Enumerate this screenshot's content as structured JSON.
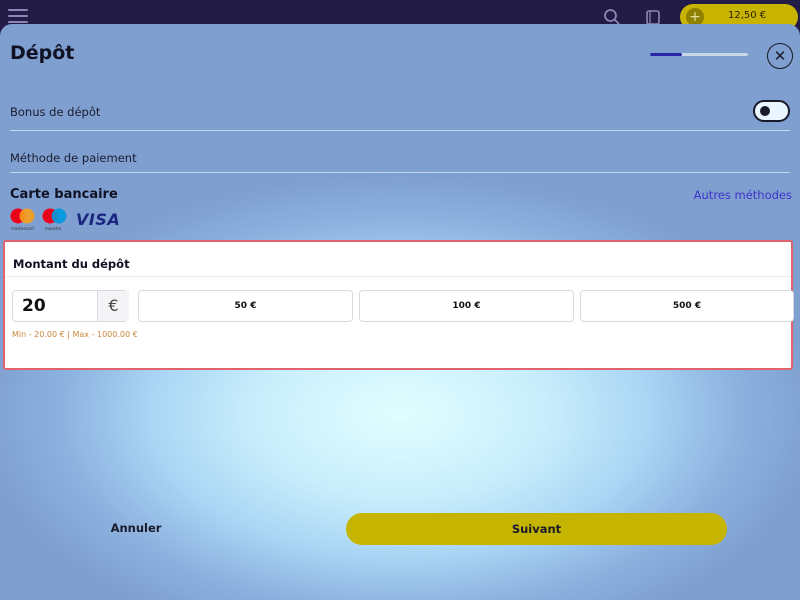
{
  "topbar": {
    "balance": "12,50 €",
    "add_label": "+",
    "icons": [
      "menu-icon",
      "search-icon",
      "wallet-icon"
    ]
  },
  "modal": {
    "title": "Dépôt",
    "close_label": "✕",
    "progress": 0.33
  },
  "bonus": {
    "label": "Bonus de dépôt",
    "enabled": false
  },
  "payment": {
    "method_label": "Méthode de paiement",
    "card_title": "Carte bancaire",
    "other_methods": "Autres méthodes",
    "logos": {
      "mastercard": "mastercard",
      "maestro": "maestro",
      "visa": "VISA"
    }
  },
  "deposit": {
    "title": "Montant du dépôt",
    "amount": "20",
    "currency": "€",
    "presets": [
      "50 €",
      "100 €",
      "500 €"
    ],
    "limits": "Min - 20.00 €  |  Max - 1000.00 €"
  },
  "footer": {
    "cancel": "Annuler",
    "next": "Suivant"
  },
  "colors": {
    "accent": "#c5b500",
    "link": "#3d33c7",
    "highlight_border": "#e0636e",
    "progress": "#2a27a8"
  }
}
